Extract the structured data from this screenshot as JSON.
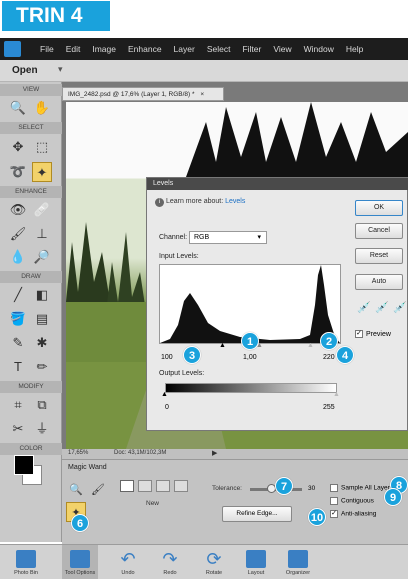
{
  "step_tag": "TRIN 4",
  "menubar": {
    "items": [
      "File",
      "Edit",
      "Image",
      "Enhance",
      "Layer",
      "Select",
      "Filter",
      "View",
      "Window",
      "Help"
    ]
  },
  "openbar": {
    "label": "Open"
  },
  "toolpanel": {
    "sections": [
      "VIEW",
      "SELECT",
      "ENHANCE",
      "DRAW",
      "MODIFY",
      "COLOR"
    ]
  },
  "document": {
    "tab_label": "IMG_2482.psd @ 17,6% (Layer 1, RGB/8) *",
    "status_zoom": "17,65%",
    "status_doc": "Doc: 43,1M/102,3M"
  },
  "levels": {
    "title": "Levels",
    "learn_prefix": "Learn more about:",
    "learn_link": "Levels",
    "channel_label": "Channel:",
    "channel_value": "RGB",
    "input_levels_label": "Input Levels:",
    "output_levels_label": "Output Levels:",
    "input_black": "100",
    "input_gamma": "1,00",
    "input_white": "220",
    "output_black": "0",
    "output_white": "255",
    "buttons": {
      "ok": "OK",
      "cancel": "Cancel",
      "reset": "Reset",
      "auto": "Auto"
    },
    "preview_label": "Preview"
  },
  "tool_options": {
    "tool_name": "Magic Wand",
    "new_label": "New",
    "tolerance_label": "Tolerance:",
    "tolerance_value": "30",
    "refine_edge": "Refine Edge...",
    "sample_all_layers": "Sample All Layers",
    "contiguous": "Contiguous",
    "anti_aliasing": "Anti-aliasing"
  },
  "bottombar": {
    "items": [
      "Photo Bin",
      "Tool Options",
      "Undo",
      "Redo",
      "Rotate",
      "Layout",
      "Organizer"
    ]
  },
  "callouts": {
    "c1": "1",
    "c2": "2",
    "c3": "3",
    "c4": "4",
    "c6": "6",
    "c7": "7",
    "c8": "8",
    "c9": "9",
    "c10": "10"
  },
  "colors": {
    "accent": "#1aa2dc",
    "menubar": "#1d1d1d",
    "selected_tool": "#f2d26a"
  }
}
